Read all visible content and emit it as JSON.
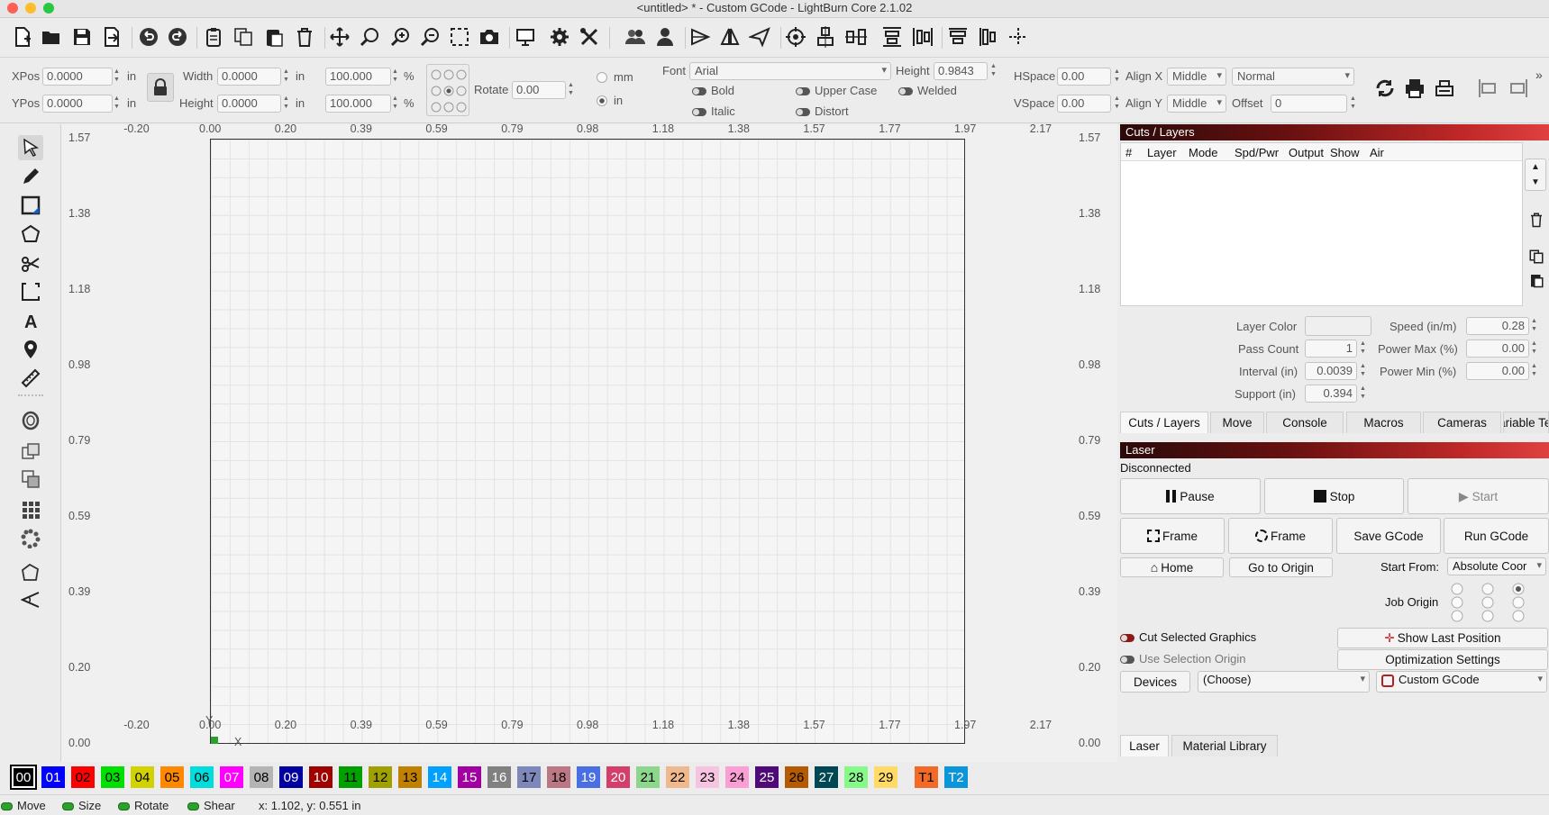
{
  "window": {
    "title": "<untitled> * - Custom GCode - LightBurn Core 2.1.02"
  },
  "props": {
    "xpos_label": "XPos",
    "xpos_value": "0.0000",
    "ypos_label": "YPos",
    "ypos_value": "0.0000",
    "unit_in": "in",
    "width_label": "Width",
    "width_value": "0.0000",
    "height_label": "Height",
    "height_value": "0.0000",
    "scale_w": "100.000",
    "scale_h": "100.000",
    "percent": "%",
    "rotate_label": "Rotate",
    "rotate_value": "0.00",
    "unit_mm": "mm",
    "unit_in2": "in",
    "selected_unit": "in",
    "font_label": "Font",
    "font_value": "Arial",
    "fheight_label": "Height",
    "fheight_value": "0.9843",
    "bold": "Bold",
    "italic": "Italic",
    "uppercase": "Upper Case",
    "distort": "Distort",
    "welded": "Welded",
    "hspace_label": "HSpace",
    "hspace_value": "0.00",
    "vspace_label": "VSpace",
    "vspace_value": "0.00",
    "alignx_label": "Align X",
    "alignx_value": "Middle",
    "aligny_label": "Align Y",
    "aligny_value": "Middle",
    "mode_value": "Normal",
    "offset_label": "Offset",
    "offset_value": "0"
  },
  "canvas": {
    "x_ticks": [
      "-0.20",
      "0.00",
      "0.20",
      "0.39",
      "0.59",
      "0.79",
      "0.98",
      "1.18",
      "1.38",
      "1.57",
      "1.77",
      "1.97",
      "2.17"
    ],
    "y_ticks": [
      "1.57",
      "1.38",
      "1.18",
      "0.98",
      "0.79",
      "0.59",
      "0.39",
      "0.20",
      "0.00"
    ],
    "x_axis": "X",
    "y_axis": "Y"
  },
  "cuts": {
    "title": "Cuts / Layers",
    "columns": [
      "#",
      "Layer",
      "Mode",
      "Spd/Pwr",
      "Output",
      "Show",
      "Air"
    ],
    "layer_color_label": "Layer Color",
    "pass_count_label": "Pass Count",
    "pass_count": "1",
    "interval_label": "Interval (in)",
    "interval": "0.0039",
    "support_label": "Support (in)",
    "support": "0.394",
    "speed_label": "Speed (in/m)",
    "speed": "0.28",
    "power_max_label": "Power Max (%)",
    "power_max": "0.00",
    "power_min_label": "Power Min (%)",
    "power_min": "0.00"
  },
  "tabs": [
    "Cuts / Layers",
    "Move",
    "Console",
    "Macros",
    "Cameras",
    "Variable Text"
  ],
  "laser": {
    "title": "Laser",
    "status": "Disconnected",
    "pause": "Pause",
    "stop": "Stop",
    "start": "Start",
    "frame1": "Frame",
    "frame2": "Frame",
    "save_gcode": "Save GCode",
    "run_gcode": "Run GCode",
    "home": "Home",
    "go_origin": "Go to Origin",
    "start_from_label": "Start From:",
    "start_from": "Absolute Coor",
    "job_origin": "Job Origin",
    "cut_selected": "Cut Selected Graphics",
    "use_selection": "Use Selection Origin",
    "show_last": "Show Last Position",
    "optimization": "Optimization Settings",
    "devices": "Devices",
    "choose": "(Choose)",
    "device": "Custom GCode"
  },
  "bottom_tabs": [
    "Laser",
    "Material Library"
  ],
  "palette": [
    {
      "label": "00",
      "bg": "#000000",
      "fg": "#ffffff"
    },
    {
      "label": "01",
      "bg": "#0000ff",
      "fg": "#ffffff"
    },
    {
      "label": "02",
      "bg": "#ff0000",
      "fg": "#000000"
    },
    {
      "label": "03",
      "bg": "#00e000",
      "fg": "#000000"
    },
    {
      "label": "04",
      "bg": "#d2d200",
      "fg": "#000000"
    },
    {
      "label": "05",
      "bg": "#ff8800",
      "fg": "#000000"
    },
    {
      "label": "06",
      "bg": "#00dddd",
      "fg": "#000000"
    },
    {
      "label": "07",
      "bg": "#ff00ff",
      "fg": "#ffffff"
    },
    {
      "label": "08",
      "bg": "#b4b4b4",
      "fg": "#000000"
    },
    {
      "label": "09",
      "bg": "#0000a0",
      "fg": "#ffffff"
    },
    {
      "label": "10",
      "bg": "#a00000",
      "fg": "#ffffff"
    },
    {
      "label": "11",
      "bg": "#00a000",
      "fg": "#000000"
    },
    {
      "label": "12",
      "bg": "#a0a000",
      "fg": "#000000"
    },
    {
      "label": "13",
      "bg": "#c08000",
      "fg": "#000000"
    },
    {
      "label": "14",
      "bg": "#00a0ff",
      "fg": "#ffffff"
    },
    {
      "label": "15",
      "bg": "#a000a0",
      "fg": "#ffffff"
    },
    {
      "label": "16",
      "bg": "#808080",
      "fg": "#ffffff"
    },
    {
      "label": "17",
      "bg": "#7d87b9",
      "fg": "#000000"
    },
    {
      "label": "18",
      "bg": "#bb7784",
      "fg": "#000000"
    },
    {
      "label": "19",
      "bg": "#4a6fe3",
      "fg": "#ffffff"
    },
    {
      "label": "20",
      "bg": "#d33f6a",
      "fg": "#ffffff"
    },
    {
      "label": "21",
      "bg": "#8cd78c",
      "fg": "#000000"
    },
    {
      "label": "22",
      "bg": "#f0b98d",
      "fg": "#000000"
    },
    {
      "label": "23",
      "bg": "#f6c4e1",
      "fg": "#000000"
    },
    {
      "label": "24",
      "bg": "#fa9ed4",
      "fg": "#000000"
    },
    {
      "label": "25",
      "bg": "#500a78",
      "fg": "#ffffff"
    },
    {
      "label": "26",
      "bg": "#b45a00",
      "fg": "#000000"
    },
    {
      "label": "27",
      "bg": "#004754",
      "fg": "#ffffff"
    },
    {
      "label": "28",
      "bg": "#86fa88",
      "fg": "#000000"
    },
    {
      "label": "29",
      "bg": "#ffdb66",
      "fg": "#000000"
    },
    {
      "label": "T1",
      "bg": "#f36926",
      "fg": "#000000"
    },
    {
      "label": "T2",
      "bg": "#0c96d9",
      "fg": "#ffffff"
    }
  ],
  "status": {
    "move": "Move",
    "size": "Size",
    "rotate": "Rotate",
    "shear": "Shear",
    "coords": "x: 1.102, y: 0.551 in"
  }
}
